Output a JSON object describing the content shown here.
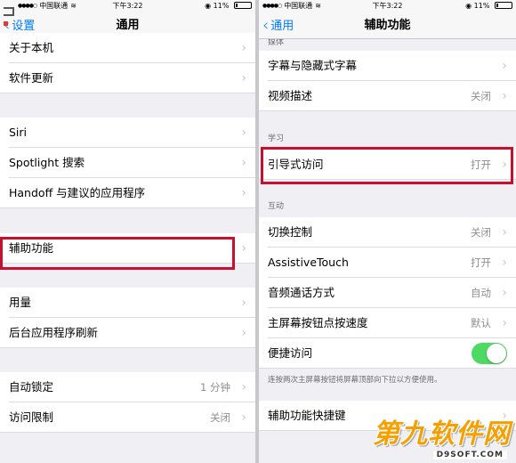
{
  "status_bar": {
    "carrier": "中国联通",
    "time": "下午3:22",
    "battery": "11%",
    "battery_level": 0.11
  },
  "left_screen": {
    "nav": {
      "back_label": "设置",
      "title": "通用"
    },
    "group1": [
      {
        "label": "关于本机"
      },
      {
        "label": "软件更新"
      }
    ],
    "group2": [
      {
        "label": "Siri"
      },
      {
        "label": "Spotlight 搜索"
      },
      {
        "label": "Handoff 与建议的应用程序"
      }
    ],
    "group3": [
      {
        "label": "辅助功能",
        "highlighted": true
      }
    ],
    "group4": [
      {
        "label": "用量"
      },
      {
        "label": "后台应用程序刷新"
      }
    ],
    "group5": [
      {
        "label": "自动锁定",
        "value": "1 分钟"
      },
      {
        "label": "访问限制",
        "value": "关闭"
      }
    ]
  },
  "right_screen": {
    "nav": {
      "back_label": "通用",
      "title": "辅助功能"
    },
    "partial_header": "媒体",
    "group_media": [
      {
        "label": "字幕与隐藏式字幕"
      },
      {
        "label": "视频描述",
        "value": "关闭"
      }
    ],
    "section_learning": "学习",
    "group_learning": [
      {
        "label": "引导式访问",
        "value": "打开",
        "highlighted": true
      }
    ],
    "section_interaction": "互动",
    "group_interaction": [
      {
        "label": "切换控制",
        "value": "关闭"
      },
      {
        "label": "AssistiveTouch",
        "value": "打开"
      },
      {
        "label": "音频通话方式",
        "value": "自动"
      },
      {
        "label": "主屏幕按钮点按速度",
        "value": "默认"
      },
      {
        "label": "便捷访问",
        "toggle": true,
        "toggle_on": true
      }
    ],
    "footnote": "连按两次主屏幕按钮将屏幕顶部向下拉以方便使用。",
    "group_shortcut": [
      {
        "label": "辅助功能快捷键"
      }
    ]
  },
  "watermark": {
    "main_text": "第九软件网",
    "url_text": "D9SOFT.COM"
  },
  "colors": {
    "accent_blue": "#007aff",
    "highlight_red": "#c8102e",
    "toggle_green": "#4cd964",
    "watermark_orange": "#f5a000"
  },
  "icons": {
    "back": "chevron-left-icon",
    "disclosure": "chevron-right-icon",
    "wifi": "wifi-icon",
    "lock": "rotation-lock-icon",
    "battery": "battery-icon"
  }
}
